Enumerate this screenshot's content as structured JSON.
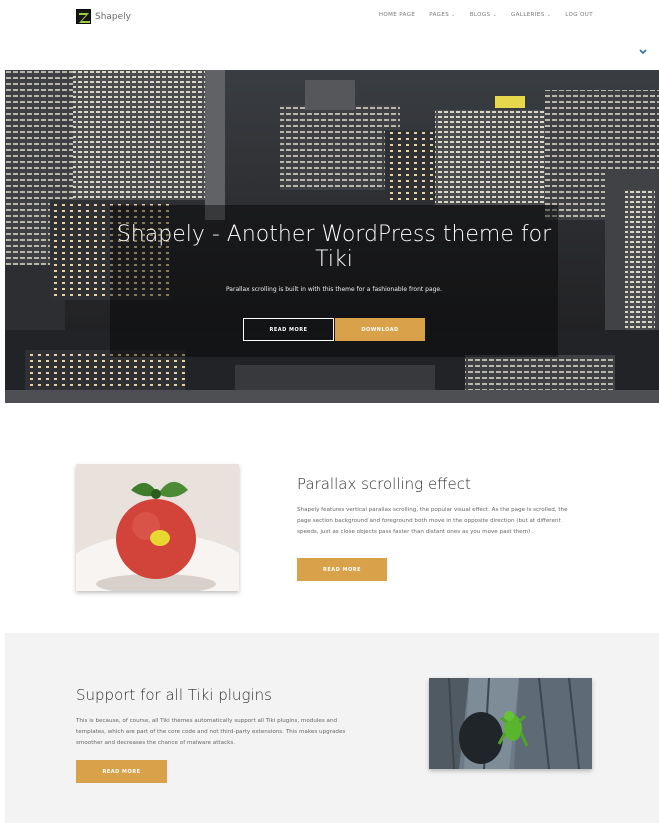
{
  "header": {
    "brand_name": "Shapely",
    "nav": [
      {
        "label": "HOME PAGE",
        "has_dropdown": false
      },
      {
        "label": "PAGES",
        "has_dropdown": true
      },
      {
        "label": "BLOGS",
        "has_dropdown": true
      },
      {
        "label": "GALLERIES",
        "has_dropdown": true
      },
      {
        "label": "LOG OUT",
        "has_dropdown": false
      }
    ],
    "collapse_icon": "chevron-down-icon"
  },
  "hero": {
    "title": "Shapely - Another WordPress theme for Tiki",
    "subtitle": "Parallax scrolling is built in with this theme for a fashionable front page.",
    "read_more_label": "READ MORE",
    "download_label": "DOWNLOAD"
  },
  "feature_parallax": {
    "title": "Parallax scrolling effect",
    "body": "Shapely features vertical parallax scrolling, the popular visual effect. As the page is scrolled, the page section background and foreground both move in the opposite direction (but at different speeds, just as close objects pass faster than distant ones as you move past them) .",
    "button_label": "READ MORE"
  },
  "feature_plugins": {
    "title": "Support for all Tiki plugins",
    "body": "This is because, of course, all Tiki themes automatically support all Tiki plugins, modules and templates, which are part of the core code and not third-party extensions. This makes upgrades smoother and decreases the chance of malware attacks.",
    "button_label": "READ MORE"
  },
  "colors": {
    "accent": "#d9a14a",
    "band_background": "#f3f3f3",
    "nav_text": "#777777"
  }
}
